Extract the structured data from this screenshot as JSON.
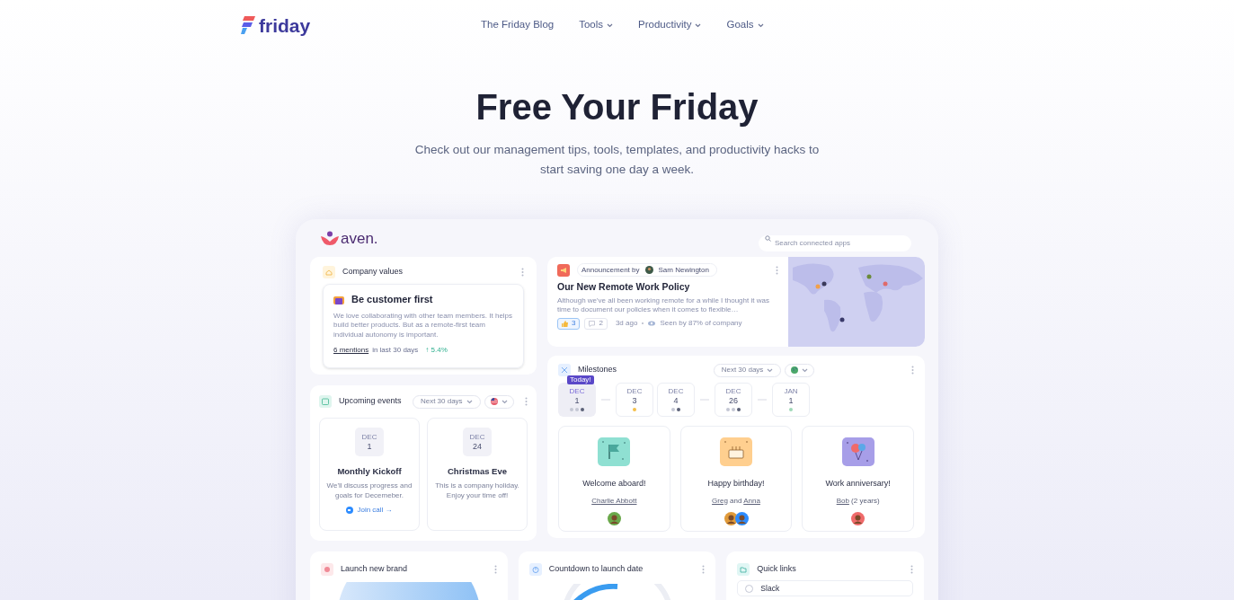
{
  "nav": {
    "logo": "friday",
    "links": [
      {
        "label": "The Friday Blog",
        "dropdown": false
      },
      {
        "label": "Tools",
        "dropdown": true
      },
      {
        "label": "Productivity",
        "dropdown": true
      },
      {
        "label": "Goals",
        "dropdown": true
      }
    ]
  },
  "hero": {
    "title": "Free Your Friday",
    "subtitle": "Check out our management tips, tools, templates, and productivity hacks to start saving one day a week."
  },
  "dashboard": {
    "logo": "aven.",
    "search": {
      "placeholder": "Search connected apps"
    },
    "company_values": {
      "title": "Company values",
      "value_title": "Be customer first",
      "description": "We love collaborating with other team members. It helps build better products. But as a remote-first team individual autonomy is important.",
      "mentions": "6 mentions",
      "period": "in last 30 days",
      "change": "↑ 5.4%"
    },
    "upcoming_events": {
      "title": "Upcoming events",
      "filter": "Next 30 days",
      "events": [
        {
          "month": "DEC",
          "day": "1",
          "title": "Monthly Kickoff",
          "description": "We'll discuss progress and goals for Decemeber.",
          "action": "Join call →"
        },
        {
          "month": "DEC",
          "day": "24",
          "title": "Christmas Eve",
          "description": "This is a company holiday. Enjoy your time off!"
        }
      ]
    },
    "announcement": {
      "label": "Announcement by",
      "author": "Sam Newington",
      "title": "Our New Remote Work Policy",
      "excerpt": "Although we've all been working remote for a while I thought it was time to document our policies when it comes to flexible…",
      "reactions": [
        {
          "kind": "like",
          "count": "3",
          "selected": true
        },
        {
          "kind": "comment",
          "count": "2",
          "selected": false
        }
      ],
      "time": "3d ago",
      "seen": "Seen by 87% of company"
    },
    "milestones": {
      "title": "Milestones",
      "filter": "Next 30 days",
      "today_badge": "Today!",
      "dates": [
        {
          "month": "DEC",
          "day": "1",
          "selected": true,
          "connector": false,
          "dots": [
            {
              "color": "#c4c7d4"
            },
            {
              "color": "#c4c7d4"
            },
            {
              "color": "#5c6178"
            }
          ]
        },
        {
          "month": "DEC",
          "day": "3",
          "selected": false,
          "connector": true,
          "dots": [
            {
              "color": "#f5c04a"
            }
          ]
        },
        {
          "month": "DEC",
          "day": "4",
          "selected": false,
          "connector": false,
          "dots": [
            {
              "color": "#c4c7d4"
            },
            {
              "color": "#5c6178"
            }
          ]
        },
        {
          "month": "DEC",
          "day": "26",
          "selected": false,
          "connector": true,
          "dots": [
            {
              "color": "#c4c7d4"
            },
            {
              "color": "#c4c7d4"
            },
            {
              "color": "#5c6178"
            }
          ]
        },
        {
          "month": "JAN",
          "day": "1",
          "selected": false,
          "connector": true,
          "dots": [
            {
              "color": "#9fd8b8"
            }
          ]
        }
      ],
      "cards": [
        {
          "kind": "welcome",
          "title": "Welcome aboard!",
          "names": [
            "Charlie Abbott"
          ]
        },
        {
          "kind": "birthday",
          "title": "Happy birthday!",
          "names": [
            "Greg",
            "Anna"
          ],
          "joiner": "and"
        },
        {
          "kind": "anniversary",
          "title": "Work anniversary!",
          "names": [
            "Bob"
          ],
          "note": "(2 years)"
        }
      ]
    },
    "widgets": [
      {
        "kind": "goal",
        "title": "Launch new brand"
      },
      {
        "kind": "countdown",
        "title": "Countdown to launch date"
      },
      {
        "kind": "links",
        "title": "Quick links",
        "items": [
          "Slack"
        ]
      }
    ]
  }
}
